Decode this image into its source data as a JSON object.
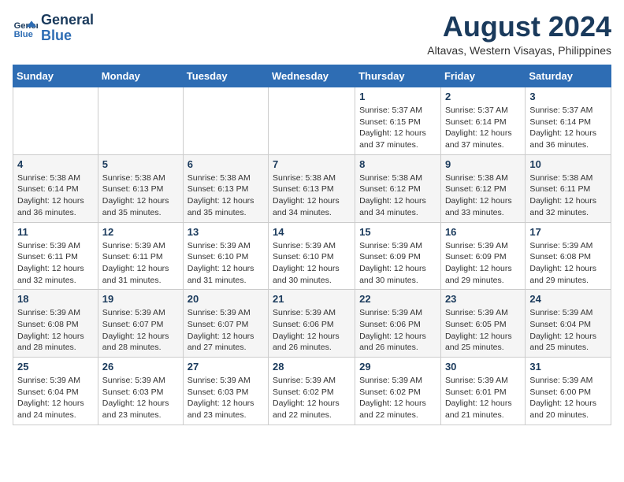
{
  "logo": {
    "line1": "General",
    "line2": "Blue"
  },
  "title": "August 2024",
  "subtitle": "Altavas, Western Visayas, Philippines",
  "days_of_week": [
    "Sunday",
    "Monday",
    "Tuesday",
    "Wednesday",
    "Thursday",
    "Friday",
    "Saturday"
  ],
  "weeks": [
    [
      {
        "day": "",
        "info": ""
      },
      {
        "day": "",
        "info": ""
      },
      {
        "day": "",
        "info": ""
      },
      {
        "day": "",
        "info": ""
      },
      {
        "day": "1",
        "info": "Sunrise: 5:37 AM\nSunset: 6:15 PM\nDaylight: 12 hours\nand 37 minutes."
      },
      {
        "day": "2",
        "info": "Sunrise: 5:37 AM\nSunset: 6:14 PM\nDaylight: 12 hours\nand 37 minutes."
      },
      {
        "day": "3",
        "info": "Sunrise: 5:37 AM\nSunset: 6:14 PM\nDaylight: 12 hours\nand 36 minutes."
      }
    ],
    [
      {
        "day": "4",
        "info": "Sunrise: 5:38 AM\nSunset: 6:14 PM\nDaylight: 12 hours\nand 36 minutes."
      },
      {
        "day": "5",
        "info": "Sunrise: 5:38 AM\nSunset: 6:13 PM\nDaylight: 12 hours\nand 35 minutes."
      },
      {
        "day": "6",
        "info": "Sunrise: 5:38 AM\nSunset: 6:13 PM\nDaylight: 12 hours\nand 35 minutes."
      },
      {
        "day": "7",
        "info": "Sunrise: 5:38 AM\nSunset: 6:13 PM\nDaylight: 12 hours\nand 34 minutes."
      },
      {
        "day": "8",
        "info": "Sunrise: 5:38 AM\nSunset: 6:12 PM\nDaylight: 12 hours\nand 34 minutes."
      },
      {
        "day": "9",
        "info": "Sunrise: 5:38 AM\nSunset: 6:12 PM\nDaylight: 12 hours\nand 33 minutes."
      },
      {
        "day": "10",
        "info": "Sunrise: 5:38 AM\nSunset: 6:11 PM\nDaylight: 12 hours\nand 32 minutes."
      }
    ],
    [
      {
        "day": "11",
        "info": "Sunrise: 5:39 AM\nSunset: 6:11 PM\nDaylight: 12 hours\nand 32 minutes."
      },
      {
        "day": "12",
        "info": "Sunrise: 5:39 AM\nSunset: 6:11 PM\nDaylight: 12 hours\nand 31 minutes."
      },
      {
        "day": "13",
        "info": "Sunrise: 5:39 AM\nSunset: 6:10 PM\nDaylight: 12 hours\nand 31 minutes."
      },
      {
        "day": "14",
        "info": "Sunrise: 5:39 AM\nSunset: 6:10 PM\nDaylight: 12 hours\nand 30 minutes."
      },
      {
        "day": "15",
        "info": "Sunrise: 5:39 AM\nSunset: 6:09 PM\nDaylight: 12 hours\nand 30 minutes."
      },
      {
        "day": "16",
        "info": "Sunrise: 5:39 AM\nSunset: 6:09 PM\nDaylight: 12 hours\nand 29 minutes."
      },
      {
        "day": "17",
        "info": "Sunrise: 5:39 AM\nSunset: 6:08 PM\nDaylight: 12 hours\nand 29 minutes."
      }
    ],
    [
      {
        "day": "18",
        "info": "Sunrise: 5:39 AM\nSunset: 6:08 PM\nDaylight: 12 hours\nand 28 minutes."
      },
      {
        "day": "19",
        "info": "Sunrise: 5:39 AM\nSunset: 6:07 PM\nDaylight: 12 hours\nand 28 minutes."
      },
      {
        "day": "20",
        "info": "Sunrise: 5:39 AM\nSunset: 6:07 PM\nDaylight: 12 hours\nand 27 minutes."
      },
      {
        "day": "21",
        "info": "Sunrise: 5:39 AM\nSunset: 6:06 PM\nDaylight: 12 hours\nand 26 minutes."
      },
      {
        "day": "22",
        "info": "Sunrise: 5:39 AM\nSunset: 6:06 PM\nDaylight: 12 hours\nand 26 minutes."
      },
      {
        "day": "23",
        "info": "Sunrise: 5:39 AM\nSunset: 6:05 PM\nDaylight: 12 hours\nand 25 minutes."
      },
      {
        "day": "24",
        "info": "Sunrise: 5:39 AM\nSunset: 6:04 PM\nDaylight: 12 hours\nand 25 minutes."
      }
    ],
    [
      {
        "day": "25",
        "info": "Sunrise: 5:39 AM\nSunset: 6:04 PM\nDaylight: 12 hours\nand 24 minutes."
      },
      {
        "day": "26",
        "info": "Sunrise: 5:39 AM\nSunset: 6:03 PM\nDaylight: 12 hours\nand 23 minutes."
      },
      {
        "day": "27",
        "info": "Sunrise: 5:39 AM\nSunset: 6:03 PM\nDaylight: 12 hours\nand 23 minutes."
      },
      {
        "day": "28",
        "info": "Sunrise: 5:39 AM\nSunset: 6:02 PM\nDaylight: 12 hours\nand 22 minutes."
      },
      {
        "day": "29",
        "info": "Sunrise: 5:39 AM\nSunset: 6:02 PM\nDaylight: 12 hours\nand 22 minutes."
      },
      {
        "day": "30",
        "info": "Sunrise: 5:39 AM\nSunset: 6:01 PM\nDaylight: 12 hours\nand 21 minutes."
      },
      {
        "day": "31",
        "info": "Sunrise: 5:39 AM\nSunset: 6:00 PM\nDaylight: 12 hours\nand 20 minutes."
      }
    ]
  ]
}
